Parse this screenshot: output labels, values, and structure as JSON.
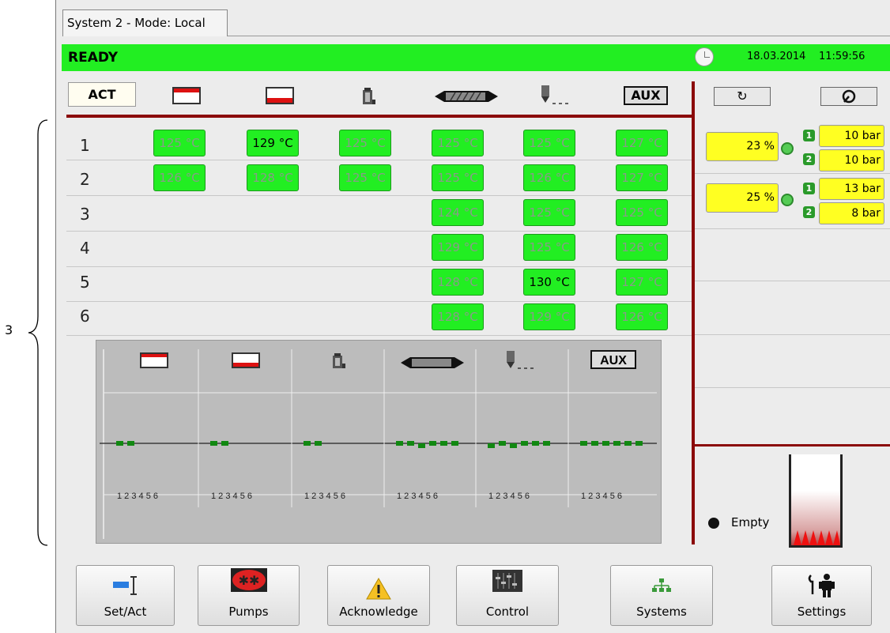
{
  "tab": {
    "label": "System 2 - Mode: Local"
  },
  "status": {
    "text": "READY",
    "date": "18.03.2014",
    "time": "11:59:56",
    "color": "#22ee22"
  },
  "header": {
    "act_label": "ACT",
    "aux_label": "AUX"
  },
  "zones": [
    "heater-top-icon",
    "heater-bottom-icon",
    "manifold-icon",
    "hose-icon",
    "nozzle-icon",
    "aux"
  ],
  "rows": [
    {
      "num": "1",
      "temps": [
        "125 °C",
        "129 °C",
        "125 °C",
        "125 °C",
        "125 °C",
        "127 °C"
      ]
    },
    {
      "num": "2",
      "temps": [
        "126 °C",
        "128 °C",
        "125 °C",
        "125 °C",
        "126 °C",
        "127 °C"
      ]
    },
    {
      "num": "3",
      "temps": [
        "",
        "",
        "",
        "124 °C",
        "125 °C",
        "125 °C"
      ]
    },
    {
      "num": "4",
      "temps": [
        "",
        "",
        "",
        "129 °C",
        "125 °C",
        "126 °C"
      ]
    },
    {
      "num": "5",
      "temps": [
        "",
        "",
        "",
        "128 °C",
        "130 °C",
        "127 °C"
      ]
    },
    {
      "num": "6",
      "temps": [
        "",
        "",
        "",
        "128 °C",
        "129 °C",
        "126 °C"
      ]
    }
  ],
  "pumps": [
    {
      "percent": "23 %",
      "p1_label": "1",
      "p1": "10 bar",
      "p2_label": "2",
      "p2": "10 bar"
    },
    {
      "percent": "25 %",
      "p1_label": "1",
      "p1": "13 bar",
      "p2_label": "2",
      "p2": "8 bar"
    }
  ],
  "chart": {
    "aux_label": "AUX",
    "tick_labels": [
      "1 2 3 4 5 6",
      "1 2 3 4 5 6",
      "1 2 3 4 5 6",
      "1 2 3 4 5 6",
      "1 2 3 4 5 6",
      "1 2 3 4 5 6"
    ],
    "marker_color": "#118811",
    "deviation": [
      [
        0,
        0,
        null,
        null,
        null,
        null
      ],
      [
        0,
        0,
        null,
        null,
        null,
        null
      ],
      [
        0,
        0,
        null,
        null,
        null,
        null
      ],
      [
        0,
        0,
        -1,
        0,
        0,
        0
      ],
      [
        -1,
        0,
        -1,
        0,
        0,
        0
      ],
      [
        0,
        0,
        0,
        0,
        0,
        0
      ]
    ]
  },
  "tank": {
    "label": "Empty"
  },
  "footer": {
    "setact": "Set/Act",
    "pumps": "Pumps",
    "acknowledge": "Acknowledge",
    "control": "Control",
    "systems": "Systems",
    "settings": "Settings"
  },
  "annotation": {
    "number": "3"
  }
}
